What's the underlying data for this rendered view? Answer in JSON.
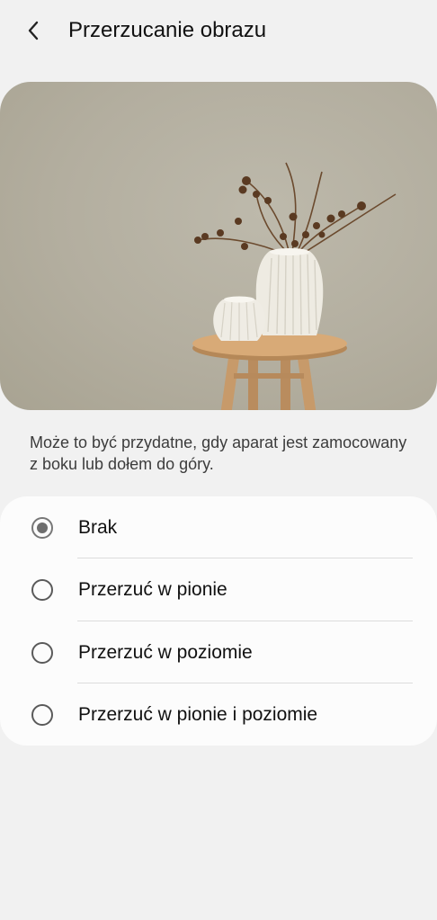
{
  "header": {
    "back_icon": "chevron-left-icon",
    "title": "Przerzucanie obrazu"
  },
  "preview": {
    "image_description_icon": "vase-preview-image"
  },
  "description": "Może to być przydatne, gdy aparat jest zamocowany z boku lub dołem do góry.",
  "options": [
    {
      "label": "Brak",
      "checked": true
    },
    {
      "label": "Przerzuć w pionie",
      "checked": false
    },
    {
      "label": "Przerzuć w poziomie",
      "checked": false
    },
    {
      "label": "Przerzuć w pionie i poziomie",
      "checked": false
    }
  ],
  "colors": {
    "background": "#f1f1f1",
    "card": "#fcfcfc",
    "radio_checked": "#6e6e6e"
  }
}
